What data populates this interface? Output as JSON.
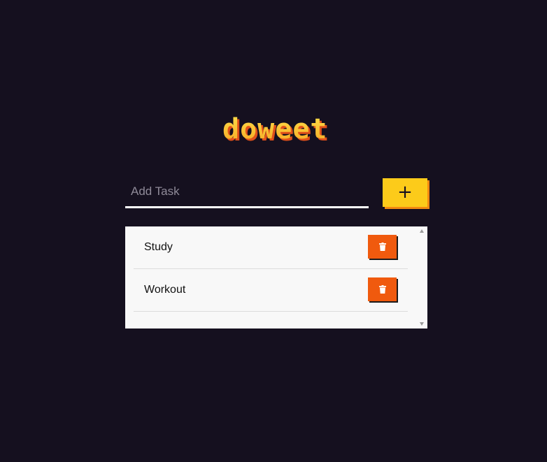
{
  "app": {
    "logo_text": "doweet"
  },
  "input": {
    "placeholder": "Add Task",
    "value": ""
  },
  "add_button": {
    "label": "+"
  },
  "tasks": [
    {
      "label": "Study"
    },
    {
      "label": "Workout"
    }
  ],
  "icons": {
    "delete": "trash-icon",
    "scroll_up": "scroll-up-arrow-icon",
    "scroll_down": "scroll-down-arrow-icon"
  },
  "colors": {
    "background": "#15101f",
    "accent_yellow": "#fccb1a",
    "accent_orange_shadow": "#f28a10",
    "delete_orange": "#f05a0e",
    "panel": "#f8f8f8"
  }
}
